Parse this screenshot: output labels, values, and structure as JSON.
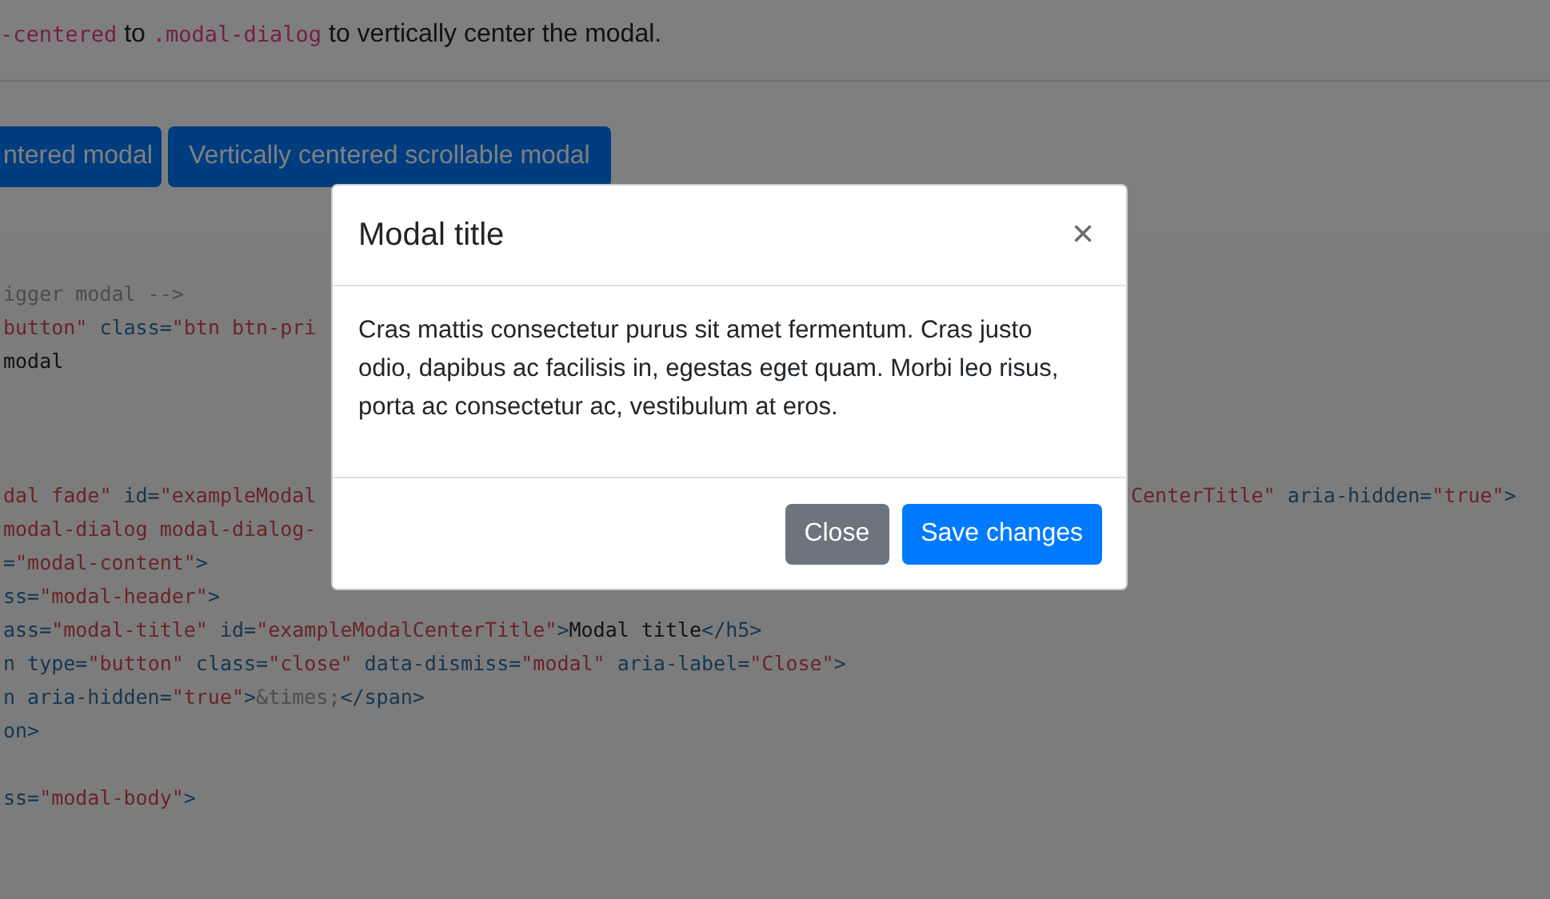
{
  "intro": [
    {
      "kind": "code",
      "text": "-centered"
    },
    {
      "kind": "text",
      "text": " to "
    },
    {
      "kind": "code",
      "text": ".modal-dialog"
    },
    {
      "kind": "text",
      "text": " to vertically center the modal."
    }
  ],
  "buttons": [
    {
      "label": "ntered modal"
    },
    {
      "label": "Vertically centered scrollable modal"
    }
  ],
  "code_blocks": [
    [
      {
        "left": [
          {
            "kind": "comment",
            "text": "igger modal -->"
          }
        ]
      },
      {
        "left": [
          {
            "kind": "string",
            "text": "button\""
          },
          {
            "kind": "attr",
            "text": " class="
          },
          {
            "kind": "string",
            "text": "\"btn btn-pri"
          }
        ]
      },
      {
        "left": [
          {
            "kind": "text",
            "text": "modal"
          }
        ]
      }
    ],
    [
      {
        "left": [
          {
            "kind": "string",
            "text": "dal fade\""
          },
          {
            "kind": "attr",
            "text": " id="
          },
          {
            "kind": "string",
            "text": "\"exampleModal"
          }
        ],
        "right": [
          {
            "kind": "string",
            "text": "CenterTitle\""
          },
          {
            "kind": "attr",
            "text": " aria-hidden="
          },
          {
            "kind": "string",
            "text": "\"true\""
          },
          {
            "kind": "punct",
            "text": ">"
          }
        ]
      },
      {
        "left": [
          {
            "kind": "string",
            "text": "modal-dialog modal-dialog-"
          }
        ]
      },
      {
        "left": [
          {
            "kind": "attr",
            "text": "="
          },
          {
            "kind": "string",
            "text": "\"modal-content\""
          },
          {
            "kind": "punct",
            "text": ">"
          }
        ]
      },
      {
        "left": [
          {
            "kind": "attr",
            "text": "ss="
          },
          {
            "kind": "string",
            "text": "\"modal-header\""
          },
          {
            "kind": "punct",
            "text": ">"
          }
        ]
      },
      {
        "left": [
          {
            "kind": "attr",
            "text": "ass="
          },
          {
            "kind": "string",
            "text": "\"modal-title\""
          },
          {
            "kind": "attr",
            "text": " id="
          },
          {
            "kind": "string",
            "text": "\"exampleModalCenterTitle\""
          },
          {
            "kind": "punct",
            "text": ">"
          },
          {
            "kind": "text",
            "text": "Modal title"
          },
          {
            "kind": "punct",
            "text": "</h5>"
          }
        ]
      },
      {
        "left": [
          {
            "kind": "attr",
            "text": "n type="
          },
          {
            "kind": "string",
            "text": "\"button\""
          },
          {
            "kind": "attr",
            "text": " class="
          },
          {
            "kind": "string",
            "text": "\"close\""
          },
          {
            "kind": "attr",
            "text": " data-dismiss="
          },
          {
            "kind": "string",
            "text": "\"modal\""
          },
          {
            "kind": "attr",
            "text": " aria-label="
          },
          {
            "kind": "string",
            "text": "\"Close\""
          },
          {
            "kind": "punct",
            "text": ">"
          }
        ]
      },
      {
        "left": [
          {
            "kind": "attr",
            "text": "n aria-hidden="
          },
          {
            "kind": "string",
            "text": "\"true\""
          },
          {
            "kind": "punct",
            "text": ">"
          },
          {
            "kind": "comment",
            "text": "&times;"
          },
          {
            "kind": "punct",
            "text": "</span>"
          }
        ]
      },
      {
        "left": [
          {
            "kind": "punct",
            "text": "on>"
          }
        ]
      }
    ],
    [
      {
        "left": [
          {
            "kind": "attr",
            "text": "ss="
          },
          {
            "kind": "string",
            "text": "\"modal-body\""
          },
          {
            "kind": "punct",
            "text": ">"
          }
        ]
      }
    ]
  ],
  "modal": {
    "title": "Modal title",
    "close_symbol": "×",
    "body": "Cras mattis consectetur purus sit amet fermentum. Cras justo odio, dapibus ac facilisis in, egestas eget quam. Morbi leo risus, porta ac consectetur ac, vestibulum at eros.",
    "buttons": [
      {
        "label": "Close",
        "kind": "secondary"
      },
      {
        "label": "Save changes",
        "kind": "primary"
      }
    ]
  }
}
